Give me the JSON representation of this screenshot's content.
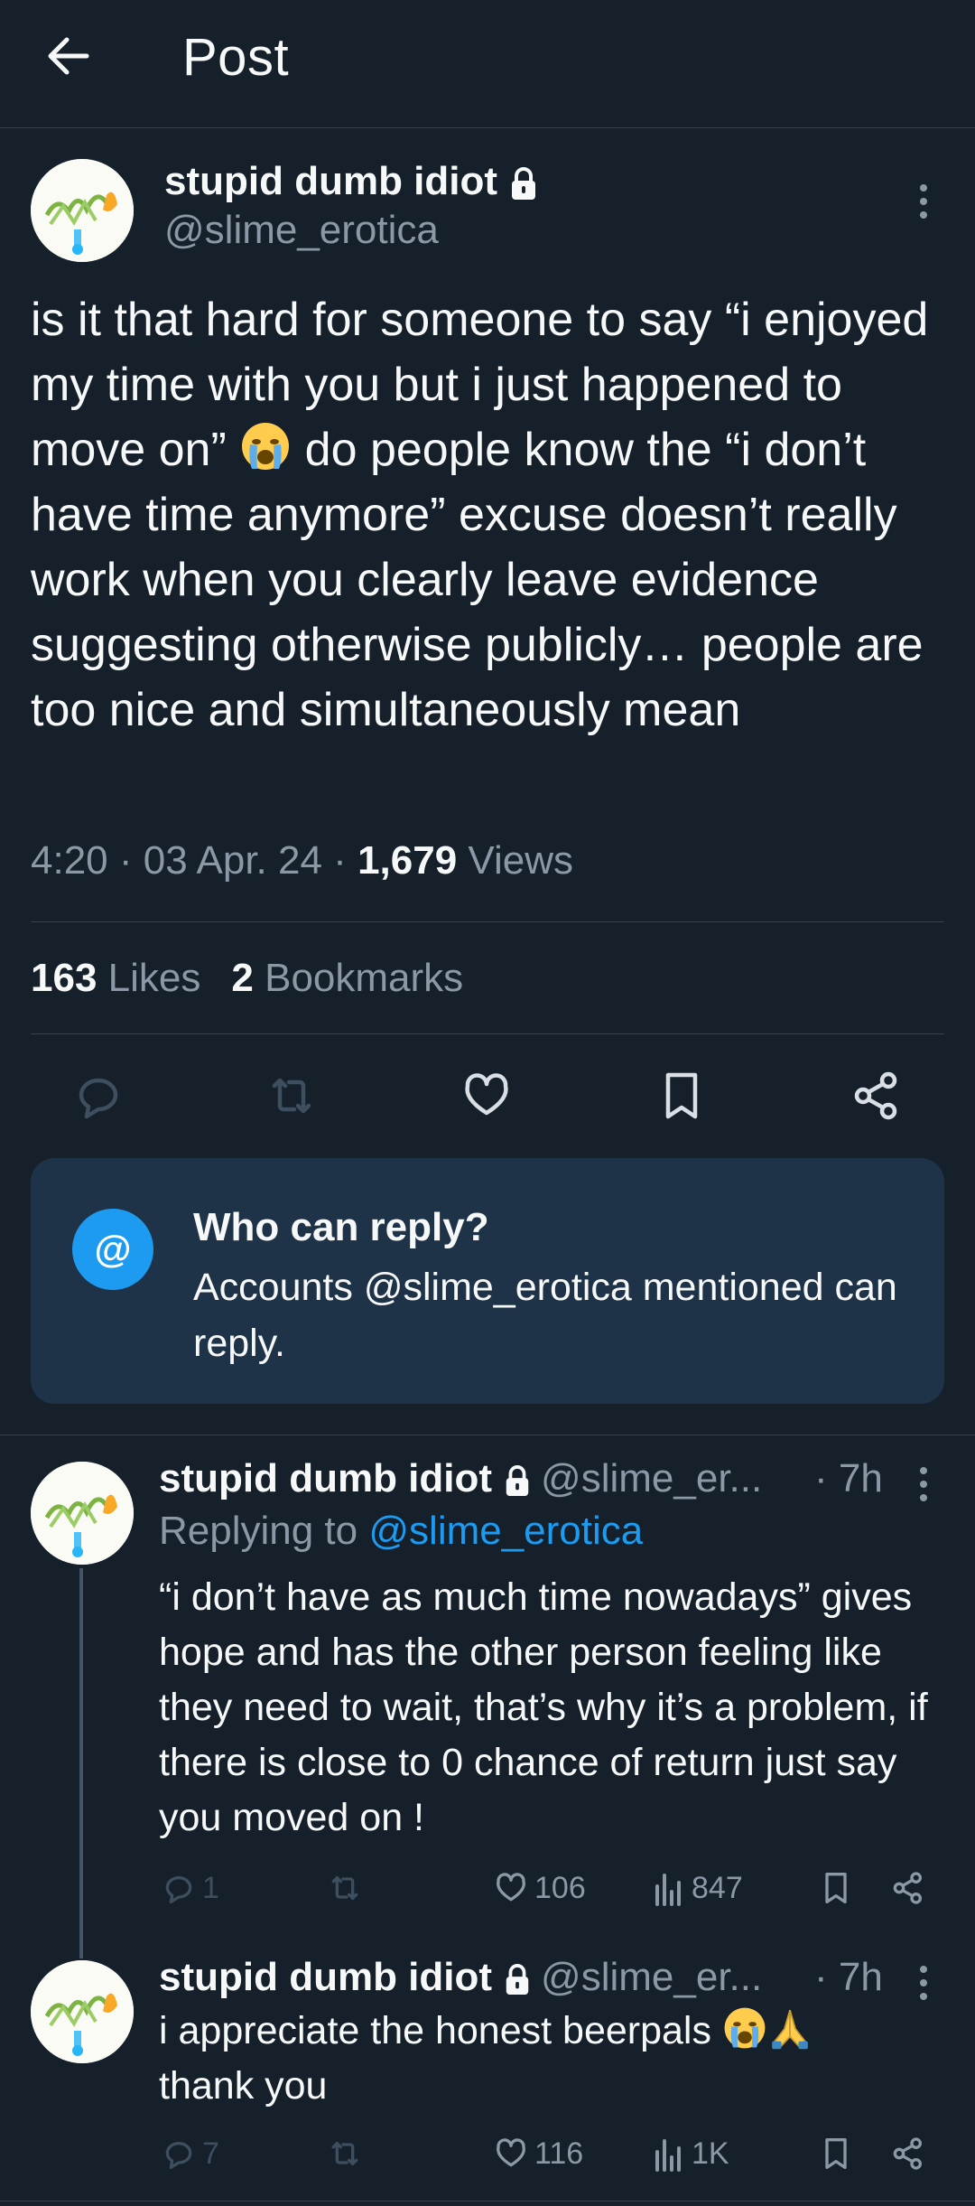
{
  "header": {
    "title": "Post",
    "back_icon": "arrow-left-icon"
  },
  "post": {
    "author_name": "stupid dumb idiot",
    "author_handle": "@slime_erotica",
    "text_parts": [
      "is it that hard for someone to say “i enjoyed my time with you but i just happened to move on” ",
      " do people know the “i don’t have time anymore” excuse doesn’t really work when you clearly leave evidence suggesting otherwise publicly… people are too nice and simultaneously mean"
    ],
    "time": "4:20",
    "date": "03 Apr. 24",
    "views_count": "1,679",
    "views_label": "Views",
    "likes_count": "163",
    "likes_label": "Likes",
    "bookmarks_count": "2",
    "bookmarks_label": "Bookmarks"
  },
  "who_can_reply": {
    "icon": "@",
    "title": "Who can reply?",
    "description": "Accounts @slime_erotica mentioned can reply."
  },
  "replies": [
    {
      "author_name": "stupid dumb idiot",
      "author_handle": "@slime_er...",
      "time": "· 7h",
      "replying_prefix": "Replying to",
      "replying_to": "@slime_erotica",
      "text": "“i don’t have as much time nowadays” gives hope and has the other person feeling like they need to wait, that’s why it’s a problem, if there is close to 0 chance of return just say you moved on !",
      "reply_count": "1",
      "like_count": "106",
      "view_count": "847"
    },
    {
      "author_name": "stupid dumb idiot",
      "author_handle": "@slime_er...",
      "time": "· 7h",
      "text_parts": [
        "i appreciate the honest beerpals ",
        "thank you"
      ],
      "reply_count": "7",
      "like_count": "116",
      "view_count": "1K"
    }
  ],
  "colors": {
    "background": "#15202b",
    "accent": "#1d9bf0",
    "muted": "#8b98a5",
    "card": "#1e3248"
  }
}
